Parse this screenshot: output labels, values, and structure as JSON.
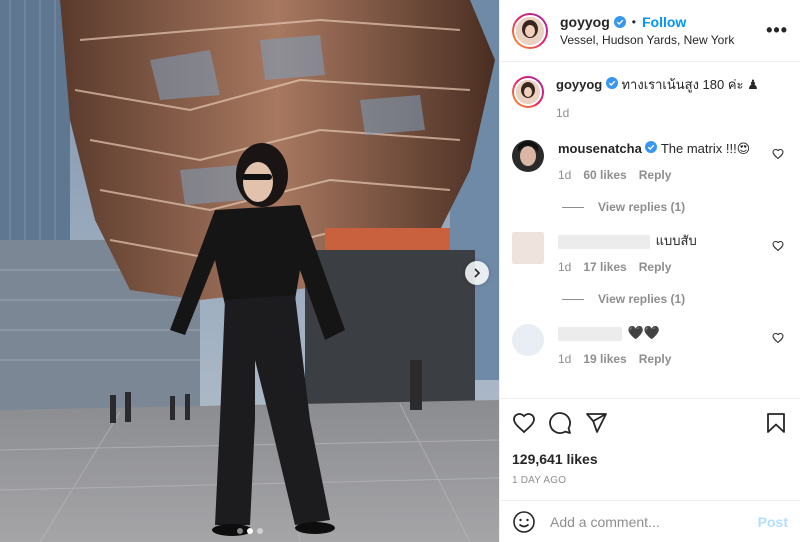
{
  "post": {
    "username": "goyyog",
    "follow_label": "Follow",
    "separator": "•",
    "location": "Vessel, Hudson Yards, New York",
    "more_label": "•••",
    "image_alt": "Woman in black leather outfit standing in front of the Vessel structure",
    "image_dots": 3,
    "active_dot": 2
  },
  "caption": {
    "username": "goyyog",
    "text": "ทางเราเน้นสูง 180 ค่ะ ♟",
    "time": "1d"
  },
  "comments": [
    {
      "username": "mousenatcha",
      "text": "The matrix !!!😍",
      "time": "1d",
      "likes": "60 likes",
      "reply_label": "Reply",
      "view_replies": "View replies (1)"
    },
    {
      "username": "",
      "text": "แบบสับ",
      "time": "1d",
      "likes": "17 likes",
      "reply_label": "Reply",
      "view_replies": "View replies (1)"
    },
    {
      "username": "",
      "text": "🖤🖤",
      "time": "1d",
      "likes": "19 likes",
      "reply_label": "Reply"
    }
  ],
  "stats": {
    "likes": "129,641 likes",
    "date": "1 DAY AGO"
  },
  "composer": {
    "placeholder": "Add a comment...",
    "post_label": "Post"
  },
  "colors": {
    "link_blue": "#0095f6",
    "post_disabled": "#b2dffc",
    "secondary_text": "#8e8e8e",
    "verified_badge": "#3897f0"
  },
  "icons": [
    "verified-badge-icon",
    "more-icon",
    "heart-icon",
    "comment-icon",
    "share-icon",
    "bookmark-icon",
    "emoji-icon",
    "chevron-right-icon"
  ]
}
